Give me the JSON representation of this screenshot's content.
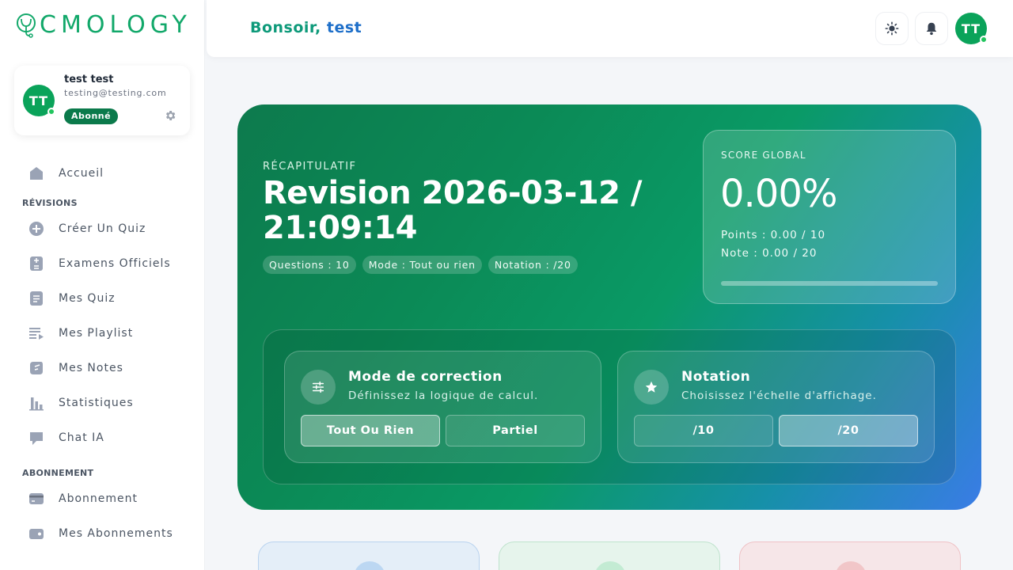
{
  "brand": {
    "name": "CMOLOGY",
    "accent": "#12a86a"
  },
  "profile": {
    "initials": "TT",
    "name": "test test",
    "email": "testing@testing.com",
    "badge": "Abonné"
  },
  "sidebar": {
    "items_top": [
      {
        "label": "Accueil",
        "icon": "home-icon"
      }
    ],
    "sections": [
      {
        "title": "RÉVISIONS",
        "items": [
          {
            "label": "Créer Un Quiz",
            "icon": "plus-circle-icon"
          },
          {
            "label": "Examens Officiels",
            "icon": "calculator-icon"
          },
          {
            "label": "Mes Quiz",
            "icon": "document-icon"
          },
          {
            "label": "Mes Playlist",
            "icon": "playlist-icon"
          },
          {
            "label": "Mes Notes",
            "icon": "notes-icon"
          },
          {
            "label": "Statistiques",
            "icon": "bar-chart-icon"
          },
          {
            "label": "Chat IA",
            "icon": "chat-icon"
          }
        ]
      },
      {
        "title": "ABONNEMENT",
        "items": [
          {
            "label": "Abonnement",
            "icon": "credit-card-icon"
          },
          {
            "label": "Mes Abonnements",
            "icon": "wallet-icon"
          }
        ]
      }
    ]
  },
  "header": {
    "greeting_prefix": "Bonsoir,",
    "greeting_user": "test",
    "avatar_initials": "TT"
  },
  "hero": {
    "eyebrow": "RÉCAPITULATIF",
    "title": "Revision 2026-03-12 / 21:09:14",
    "chips": [
      "Questions : 10",
      "Mode : Tout ou rien",
      "Notation : /20"
    ],
    "score": {
      "label": "SCORE GLOBAL",
      "value": "0.00%",
      "progress_percent": 0,
      "points": "Points : 0.00 / 10",
      "note": "Note : 0.00 / 20"
    },
    "correction": {
      "title": "Mode de correction",
      "desc": "Définissez la logique de calcul.",
      "options": [
        "Tout Ou Rien",
        "Partiel"
      ],
      "selected": "Tout Ou Rien"
    },
    "notation": {
      "title": "Notation",
      "desc": "Choisissez l'échelle d'affichage.",
      "options": [
        "/10",
        "/20"
      ],
      "selected": "/20"
    }
  },
  "colors": {
    "hero_gradient_start": "#0d7a4d",
    "hero_gradient_end": "#3a7ce6",
    "green": "#0aa35a",
    "greeting": "#0e9a7a",
    "greeting_user": "#1e6fc9"
  }
}
